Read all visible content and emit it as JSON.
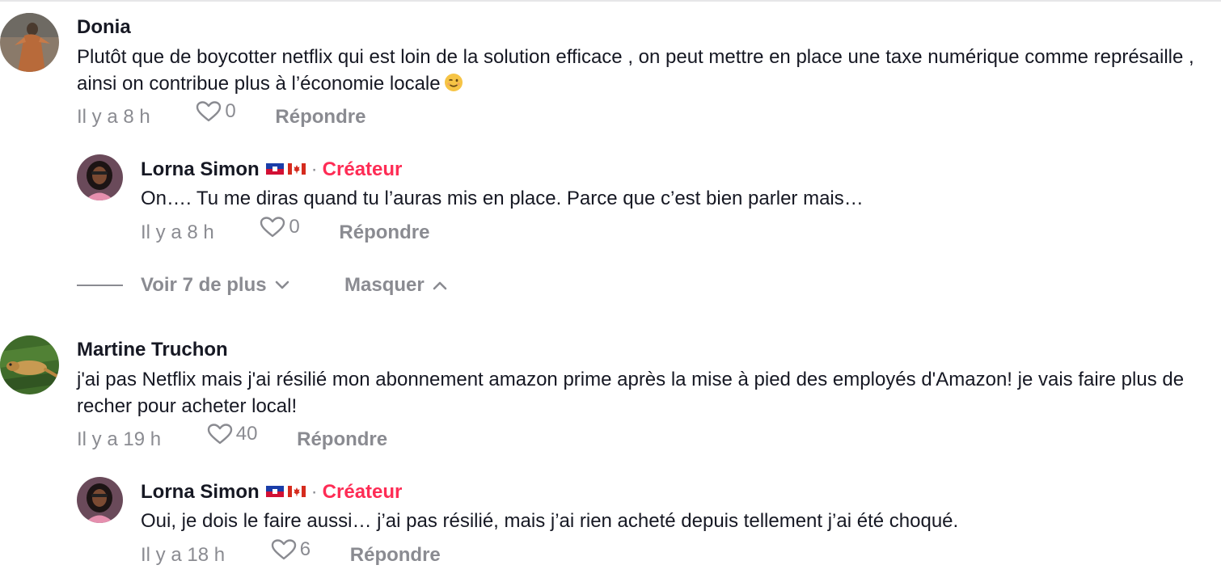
{
  "comments": [
    {
      "author": "Donia",
      "text": "Plutôt que de boycotter netflix qui est loin de la solution efficace , on peut mettre en place une taxe numérique comme représaille , ainsi on contribue plus à l’économie locale",
      "time": "Il y a 8 h",
      "likes": "0",
      "reply_label": "Répondre",
      "avatar_icon": "avatar-photo-person-icon",
      "emoji": "winking-face-emoji"
    },
    {
      "author": "Lorna Simon",
      "flags": [
        "haiti-flag-icon",
        "canada-flag-icon"
      ],
      "separator": "·",
      "badge": "Créateur",
      "text": "On…. Tu me diras quand tu l’auras mis en place. Parce que c’est bien parler mais…",
      "time": "Il y a 8 h",
      "likes": "0",
      "reply_label": "Répondre",
      "avatar_icon": "avatar-photo-woman-icon"
    },
    {
      "author": "Martine Truchon",
      "text": "j'ai pas Netflix mais j'ai résilié mon abonnement amazon prime après la mise à pied des employés d'Amazon! je vais faire plus de recher pour acheter local!",
      "time": "Il y a 19 h",
      "likes": "40",
      "reply_label": "Répondre",
      "avatar_icon": "avatar-photo-gecko-icon"
    },
    {
      "author": "Lorna Simon",
      "flags": [
        "haiti-flag-icon",
        "canada-flag-icon"
      ],
      "separator": "·",
      "badge": "Créateur",
      "text": "Oui, je dois le faire aussi… j’ai pas résilié, mais j’ai rien acheté depuis tellement j’ai été choqué.",
      "time": "Il y a 18 h",
      "likes": "6",
      "reply_label": "Répondre",
      "avatar_icon": "avatar-photo-woman-icon"
    }
  ],
  "thread": {
    "view_more_label": "Voir 7 de plus",
    "hide_label": "Masquer"
  },
  "colors": {
    "creator_badge": "#fe2c55",
    "meta_text": "#8a8b91",
    "body_text": "#161823"
  }
}
